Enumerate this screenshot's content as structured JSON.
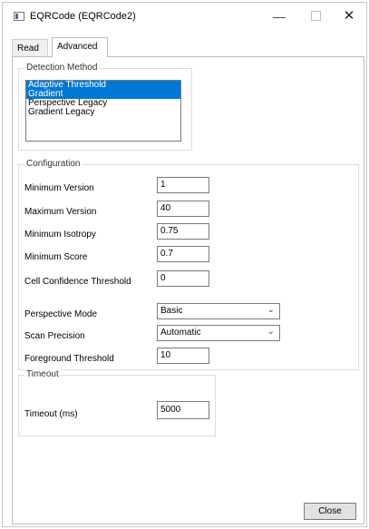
{
  "window": {
    "title": "EQRCode (EQRCode2)",
    "controls": {
      "minimize": "—",
      "maximize": "",
      "close": "✕"
    }
  },
  "tabs": [
    {
      "label": "Read",
      "selected": false
    },
    {
      "label": "Advanced",
      "selected": true
    }
  ],
  "detection": {
    "label": "Detection Method",
    "items": [
      "Adaptive Threshold",
      "Gradient",
      "Perspective Legacy",
      "Gradient Legacy"
    ],
    "selected": [
      "Adaptive Threshold",
      "Gradient"
    ]
  },
  "configuration": {
    "label": "Configuration",
    "fields": {
      "min_version": {
        "label": "Minimum Version",
        "value": "1"
      },
      "max_version": {
        "label": "Maximum Version",
        "value": "40"
      },
      "min_isotropy": {
        "label": "Minimum Isotropy",
        "value": "0.75"
      },
      "min_score": {
        "label": "Minimum Score",
        "value": "0.7"
      },
      "cell_confidence": {
        "label": "Cell Confidence Threshold",
        "value": "0"
      },
      "perspective_mode": {
        "label": "Perspective Mode",
        "value": "Basic"
      },
      "scan_precision": {
        "label": "Scan Precision",
        "value": "Automatic"
      },
      "foreground_threshold": {
        "label": "Foreground Threshold",
        "value": "10"
      }
    }
  },
  "timeout": {
    "label": "Timeout",
    "field": {
      "label": "Timeout (ms)",
      "value": "5000"
    }
  },
  "buttons": {
    "close": "Close"
  },
  "colors": {
    "selection": "#0078d7",
    "border": "#7a7a7a"
  }
}
